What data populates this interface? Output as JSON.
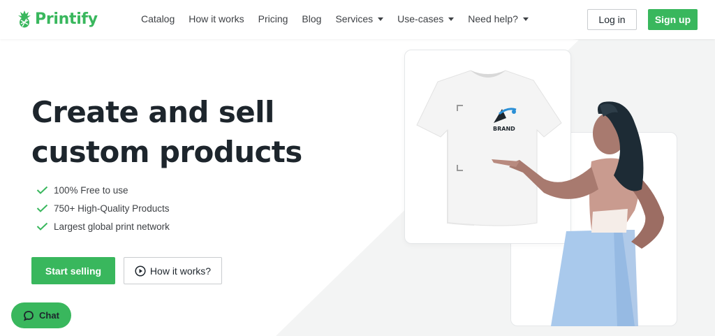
{
  "brand": {
    "name": "Printify",
    "accent": "#39b75d"
  },
  "nav": {
    "items": [
      {
        "label": "Catalog",
        "dropdown": false
      },
      {
        "label": "How it works",
        "dropdown": false
      },
      {
        "label": "Pricing",
        "dropdown": false
      },
      {
        "label": "Blog",
        "dropdown": false
      },
      {
        "label": "Services",
        "dropdown": true
      },
      {
        "label": "Use-cases",
        "dropdown": true
      },
      {
        "label": "Need help?",
        "dropdown": true
      }
    ],
    "login_label": "Log in",
    "signup_label": "Sign up"
  },
  "hero": {
    "headline_line1": "Create and sell",
    "headline_line2": "custom products",
    "features": [
      "100% Free to use",
      "750+ High-Quality Products",
      "Largest global print network"
    ],
    "start_label": "Start selling",
    "how_label": "How it works?",
    "how_icon": "play-circle-icon"
  },
  "product": {
    "brand_text": "BRAND"
  },
  "chat": {
    "label": "Chat",
    "icon": "chat-bubble-icon"
  }
}
